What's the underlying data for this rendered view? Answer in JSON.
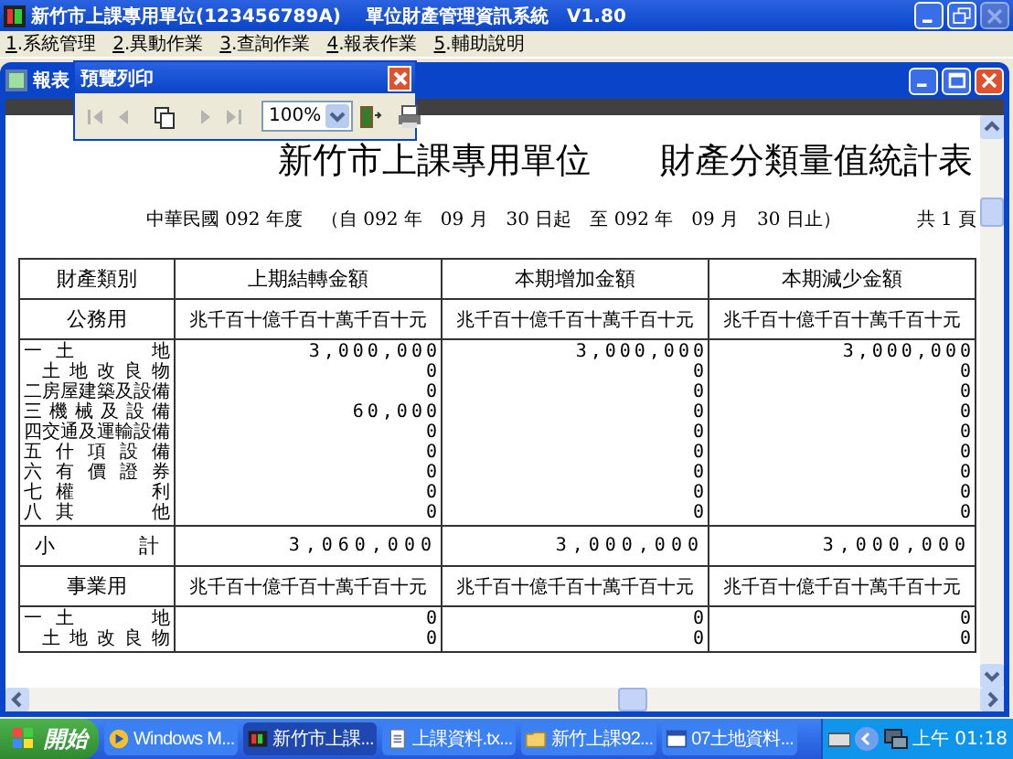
{
  "window": {
    "title": "新竹市上課專用單位(123456789A)　 單位財產管理資訊系統　V1.80",
    "controls": [
      {
        "kind": "minimize",
        "disabled": false
      },
      {
        "kind": "restore",
        "disabled": false
      },
      {
        "kind": "close",
        "disabled": true
      }
    ]
  },
  "menu": [
    {
      "label": "1.系統管理"
    },
    {
      "label": "2.異動作業"
    },
    {
      "label": "3.查詢作業"
    },
    {
      "label": "4.報表作業"
    },
    {
      "label": "5.輔助說明"
    }
  ],
  "child_window": {
    "title": "報表",
    "controls": [
      {
        "kind": "minimize",
        "disabled": false
      },
      {
        "kind": "maximize",
        "disabled": false
      },
      {
        "kind": "close",
        "disabled": false
      }
    ]
  },
  "preview_toolbar": {
    "title": "預覽列印",
    "zoom": "100%",
    "buttons": [
      {
        "kind": "first",
        "disabled": true
      },
      {
        "kind": "prev",
        "disabled": true
      },
      {
        "kind": "pages",
        "disabled": false
      },
      {
        "kind": "next",
        "disabled": true
      },
      {
        "kind": "last",
        "disabled": true
      },
      {
        "kind": "zoom"
      },
      {
        "kind": "exit",
        "disabled": false
      },
      {
        "kind": "print",
        "disabled": false
      }
    ]
  },
  "report": {
    "title": "新竹市上課專用單位　　財產分類量值統計表",
    "period": "中華民國 092 年度　（自 092 年　09 月　30 日起　至 092 年　09 月　30 日止）",
    "pages": "共 1 頁",
    "columns": [
      "財產類別",
      "上期結轉金額",
      "本期增加金額",
      "本期減少金額"
    ],
    "sections": [
      {
        "name": "公務用",
        "units": [
          "兆千百十億千百十萬千百十元",
          "兆千百十億千百十萬千百十元",
          "兆千百十億千百十萬千百十元"
        ],
        "items": [
          {
            "label": "一土　　地",
            "indent": false,
            "values": [
              "3,000,000",
              "3,000,000",
              "3,000,000"
            ]
          },
          {
            "label": "土地改良物",
            "indent": true,
            "values": [
              "0",
              "0",
              "0"
            ]
          },
          {
            "label": "二房屋建築及設備",
            "indent": false,
            "values": [
              "0",
              "0",
              "0"
            ]
          },
          {
            "label": "三機械及設備",
            "indent": false,
            "values": [
              "60,000",
              "0",
              "0"
            ]
          },
          {
            "label": "四交通及運輸設備",
            "indent": false,
            "values": [
              "0",
              "0",
              "0"
            ]
          },
          {
            "label": "五什項設備",
            "indent": false,
            "values": [
              "0",
              "0",
              "0"
            ]
          },
          {
            "label": "六有價證券",
            "indent": false,
            "values": [
              "0",
              "0",
              "0"
            ]
          },
          {
            "label": "七權　　利",
            "indent": false,
            "values": [
              "0",
              "0",
              "0"
            ]
          },
          {
            "label": "八其　　他",
            "indent": false,
            "values": [
              "0",
              "0",
              "0"
            ]
          }
        ],
        "subtotal": {
          "label": "小　　計",
          "values": [
            "3,060,000",
            "3,000,000",
            "3,000,000"
          ]
        }
      },
      {
        "name": "事業用",
        "units": [
          "兆千百十億千百十萬千百十元",
          "兆千百十億千百十萬千百十元",
          "兆千百十億千百十萬千百十元"
        ],
        "items": [
          {
            "label": "一土　　地",
            "indent": false,
            "values": [
              "0",
              "0",
              "0"
            ]
          },
          {
            "label": "土地改良物",
            "indent": true,
            "values": [
              "0",
              "0",
              "0"
            ]
          }
        ]
      }
    ]
  },
  "taskbar": {
    "start": "開始",
    "items": [
      {
        "kind": "media",
        "label": "Windows M...",
        "selected": false
      },
      {
        "kind": "app",
        "label": "新竹市上課...",
        "selected": true
      },
      {
        "kind": "document",
        "label": "上課資料.tx...",
        "selected": false
      },
      {
        "kind": "folder",
        "label": "新竹上課92...",
        "selected": false
      },
      {
        "kind": "window",
        "label": "07土地資料...",
        "selected": false
      }
    ],
    "clock": "上午 01:18"
  }
}
